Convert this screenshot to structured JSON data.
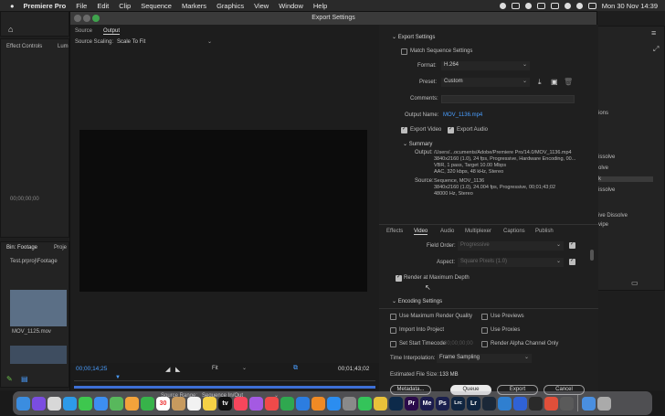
{
  "menubar": {
    "app_name": "Premiere Pro",
    "items": [
      "File",
      "Edit",
      "Clip",
      "Sequence",
      "Markers",
      "Graphics",
      "View",
      "Window",
      "Help"
    ],
    "datetime": "Mon 30 Nov  14:39"
  },
  "background": {
    "effect_controls": "Effect Controls",
    "lum": "Lum",
    "timecode_left": "00;00;00;00",
    "bin_tab": "Bin: Footage",
    "proj_tab": "Proje",
    "bin_path": "Test.prproj\\Footage",
    "clip1": "MOV_1125.mov",
    "right_items": [
      "ions",
      "issolve",
      "olve",
      "k",
      "issolve",
      "ive Dissolve",
      "vipe"
    ]
  },
  "dialog": {
    "title": "Export Settings",
    "source_tab": "Source",
    "output_tab": "Output",
    "source_scaling_label": "Source Scaling:",
    "source_scaling_value": "Scale To Fit",
    "timecode_in": "00;00;14;25",
    "fit": "Fit",
    "timecode_out": "00;01;43;02",
    "source_range_label": "Source Range:",
    "source_range_value": "Sequence In/Out",
    "export_settings_head": "Export Settings",
    "match_sequence": "Match Sequence Settings",
    "format_label": "Format:",
    "format_value": "H.264",
    "preset_label": "Preset:",
    "preset_value": "Custom",
    "comments_label": "Comments:",
    "output_name_label": "Output Name:",
    "output_name_value": "MOV_1136.mp4",
    "export_video": "Export Video",
    "export_audio": "Export Audio",
    "summary_head": "Summary",
    "output_label": "Output:",
    "output_text": "/Users/...ocuments/Adobe/Premiere Pro/14.0/MOV_1136.mp4\n3840x2160 (1.0), 24 fps, Progressive, Hardware Encoding, 00...\nVBR, 1 pass, Target 10.00 Mbps\nAAC, 320 kbps, 48 kHz, Stereo",
    "source_label": "Source:",
    "source_text": "Sequence, MOV_1136\n3840x2160 (1.0), 24.004 fps, Progressive, 00;01;43;02\n48000 Hz, Stereo",
    "tabs": [
      "Effects",
      "Video",
      "Audio",
      "Multiplexer",
      "Captions",
      "Publish"
    ],
    "field_order_label": "Field Order:",
    "field_order_value": "Progressive",
    "aspect_label": "Aspect:",
    "aspect_value": "Square Pixels (1.0)",
    "render_max_depth": "Render at Maximum Depth",
    "encoding_settings": "Encoding Settings",
    "use_max_render": "Use Maximum Render Quality",
    "use_previews": "Use Previews",
    "import_into_project": "Import Into Project",
    "use_proxies": "Use Proxies",
    "set_start_timecode": "Set Start Timecode",
    "start_timecode_value": "00;00;00;00",
    "render_alpha": "Render Alpha Channel Only",
    "time_interp_label": "Time Interpolation:",
    "time_interp_value": "Frame Sampling",
    "est_file_size_label": "Estimated File Size:",
    "est_file_size_value": "133 MB",
    "metadata_btn": "Metadata...",
    "queue_btn": "Queue",
    "export_btn": "Export",
    "cancel_btn": "Cancel"
  },
  "dock": {
    "apps": [
      {
        "icon": "finder-icon",
        "color": "#3b8de0",
        "label": ""
      },
      {
        "icon": "siri-icon",
        "color": "#7a4de0",
        "label": ""
      },
      {
        "icon": "launchpad-icon",
        "color": "#d8d8d8",
        "label": ""
      },
      {
        "icon": "safari-icon",
        "color": "#2d9ae8",
        "label": ""
      },
      {
        "icon": "messages-icon",
        "color": "#3ec74e",
        "label": ""
      },
      {
        "icon": "mail-icon",
        "color": "#3d8ef0",
        "label": ""
      },
      {
        "icon": "maps-icon",
        "color": "#58b85c",
        "label": ""
      },
      {
        "icon": "photos-icon",
        "color": "#f3a33b",
        "label": ""
      },
      {
        "icon": "facetime-icon",
        "color": "#37b34a",
        "label": ""
      },
      {
        "icon": "calendar-icon",
        "color": "#ffffff",
        "label": "30"
      },
      {
        "icon": "contacts-icon",
        "color": "#c79a5e",
        "label": ""
      },
      {
        "icon": "reminders-icon",
        "color": "#f2f2f2",
        "label": ""
      },
      {
        "icon": "notes-icon",
        "color": "#f5d146",
        "label": ""
      },
      {
        "icon": "appletv-icon",
        "color": "#111111",
        "label": "tv"
      },
      {
        "icon": "music-icon",
        "color": "#f6465c",
        "label": ""
      },
      {
        "icon": "podcasts-icon",
        "color": "#a45ae2",
        "label": ""
      },
      {
        "icon": "news-icon",
        "color": "#f04a4a",
        "label": ""
      },
      {
        "icon": "numbers-icon",
        "color": "#2fa84f",
        "label": ""
      },
      {
        "icon": "keynote-icon",
        "color": "#2c7de0",
        "label": ""
      },
      {
        "icon": "pages-icon",
        "color": "#f08a24",
        "label": ""
      },
      {
        "icon": "appstore-icon",
        "color": "#2b8df0",
        "label": ""
      },
      {
        "icon": "settings-icon",
        "color": "#8a8a8a",
        "label": ""
      },
      {
        "icon": "whatsapp-icon",
        "color": "#34c45a",
        "label": ""
      },
      {
        "icon": "chrome-icon",
        "color": "#e8c13a",
        "label": ""
      },
      {
        "icon": "photoshop-icon",
        "color": "#0d2a4a",
        "label": ""
      },
      {
        "icon": "premiere-icon",
        "color": "#2a0a4a",
        "label": "Pr"
      },
      {
        "icon": "media-encoder-icon",
        "color": "#1b1b4d",
        "label": "Me"
      },
      {
        "icon": "premiere-rush-icon",
        "color": "#1a1f4d",
        "label": "Ps"
      },
      {
        "icon": "lightroom-classic-icon",
        "color": "#0f2540",
        "label": "Lrc"
      },
      {
        "icon": "lightroom-icon",
        "color": "#0f2540",
        "label": "Lr"
      },
      {
        "icon": "steam-icon",
        "color": "#1b2838",
        "label": ""
      },
      {
        "icon": "vscode-icon",
        "color": "#2f7fd0",
        "label": ""
      },
      {
        "icon": "browser-icon",
        "color": "#3062d6",
        "label": ""
      },
      {
        "icon": "obs-icon",
        "color": "#2a2a2a",
        "label": ""
      },
      {
        "icon": "app-icon-a",
        "color": "#e04f3a",
        "label": ""
      },
      {
        "icon": "app-icon-b",
        "color": "#5a5a5a",
        "label": ""
      },
      {
        "icon": "folder-icon",
        "color": "#4a8fe0",
        "label": ""
      },
      {
        "icon": "trash-icon",
        "color": "#aaaaaa",
        "label": ""
      }
    ]
  }
}
